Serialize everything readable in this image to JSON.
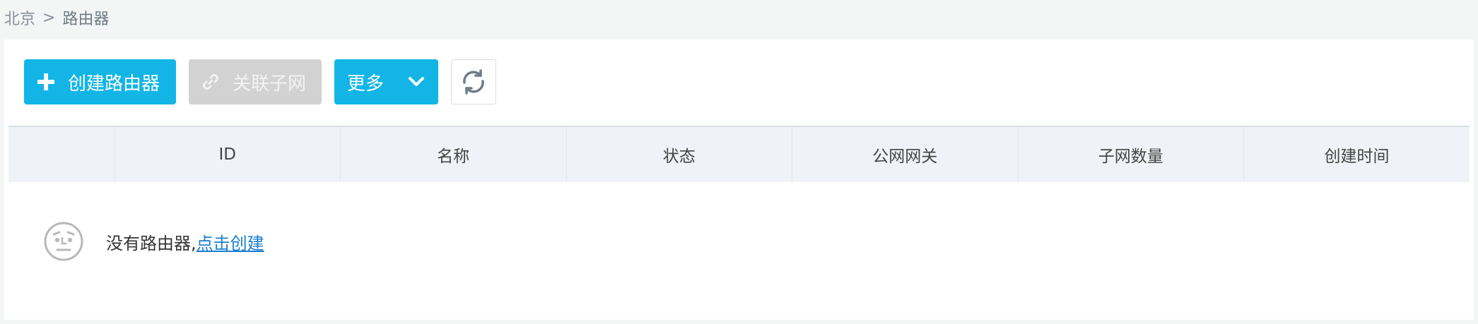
{
  "breadcrumb": {
    "region": "北京",
    "separator": ">",
    "current": "路由器"
  },
  "toolbar": {
    "create_label": "创建路由器",
    "create_icon": "plus-icon",
    "link_label": "关联子网",
    "link_icon": "link-icon",
    "more_label": "更多",
    "more_icon": "chevron-down-icon",
    "refresh_icon": "refresh-icon"
  },
  "table": {
    "columns": [
      "",
      "ID",
      "名称",
      "状态",
      "公网网关",
      "子网数量",
      "创建时间"
    ],
    "rows": []
  },
  "empty": {
    "icon": "confused-face-icon",
    "message": "没有路由器,",
    "link_text": "点击创建"
  },
  "colors": {
    "primary": "#12b5e6",
    "disabled": "#d2d2d2",
    "link": "#1a7fd0"
  }
}
